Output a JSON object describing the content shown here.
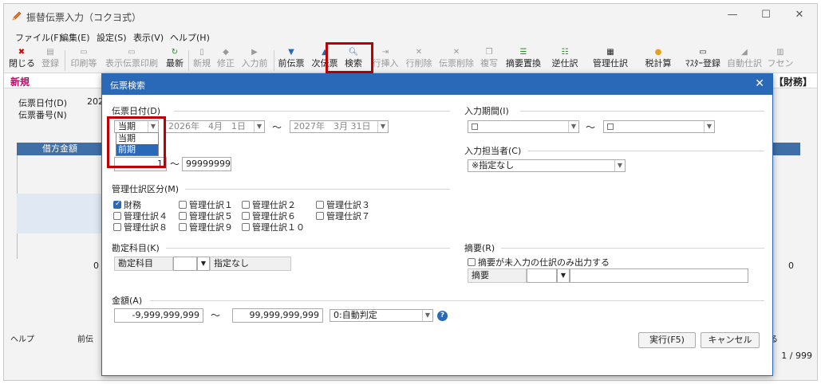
{
  "window": {
    "title": "振替伝票入力（コクヨ式）",
    "controls": {
      "minimize": "—",
      "maximize": "☐",
      "close": "✕"
    }
  },
  "menu": [
    "ファイル(F)",
    "編集(E)",
    "設定(S)",
    "表示(V)",
    "ヘルプ(H)"
  ],
  "toolbar": [
    {
      "label": "閉じる",
      "icon": "close-icon"
    },
    {
      "label": "登録",
      "icon": "register-icon"
    },
    {
      "label": "印刷等",
      "icon": "printer-icon"
    },
    {
      "label": "表示伝票印刷",
      "icon": "printer-icon"
    },
    {
      "label": "最新",
      "icon": "refresh-icon"
    },
    {
      "label": "新規",
      "icon": "new-doc-icon"
    },
    {
      "label": "修正",
      "icon": "edit-icon"
    },
    {
      "label": "入力前",
      "icon": "before-icon"
    },
    {
      "label": "前伝票",
      "icon": "prev-slip-icon"
    },
    {
      "label": "次伝票",
      "icon": "next-slip-icon"
    },
    {
      "label": "検索",
      "icon": "search-icon"
    },
    {
      "label": "行挿入",
      "icon": "row-insert-icon"
    },
    {
      "label": "行削除",
      "icon": "row-delete-icon"
    },
    {
      "label": "伝票削除",
      "icon": "slip-delete-icon"
    },
    {
      "label": "複写",
      "icon": "copy-icon"
    },
    {
      "label": "摘要置換",
      "icon": "replace-icon"
    },
    {
      "label": "逆仕訳",
      "icon": "reverse-icon"
    },
    {
      "label": "管理仕訳",
      "icon": "manage-icon"
    },
    {
      "label": "税計算",
      "icon": "tax-icon"
    },
    {
      "label": "ﾏｽﾀｰ登録",
      "icon": "master-icon"
    },
    {
      "label": "自動仕訳",
      "icon": "auto-icon"
    },
    {
      "label": "フセン",
      "icon": "sticky-icon"
    }
  ],
  "tab": {
    "new": "新規",
    "mode": "【財務】"
  },
  "background": {
    "date_label": "伝票日付(D)",
    "date_value": "202",
    "number_label": "伝票番号(N)",
    "debit_header": "借方金額",
    "debit_total": "0",
    "credit_total": "0",
    "status_help": "ヘルプ",
    "status_prev": "前伝",
    "status_suffix": "る",
    "page": "1 / 999"
  },
  "dialog": {
    "title": "伝票検索",
    "slip_date": {
      "label": "伝票日付(D)",
      "period_selected": "当期",
      "period_options": [
        "当期",
        "前期"
      ],
      "from_date": "2026年　4月　1日",
      "to_date": "2027年　3月 31日"
    },
    "slip_number": {
      "from": "1",
      "to": "99999999"
    },
    "input_period": {
      "label": "入力期間(I)"
    },
    "input_person": {
      "label": "入力担当者(C)",
      "value": "※指定なし"
    },
    "mgmt": {
      "label": "管理仕訳区分(M)",
      "items": [
        {
          "label": "財務",
          "checked": true
        },
        {
          "label": "管理仕訳１",
          "checked": false
        },
        {
          "label": "管理仕訳２",
          "checked": false
        },
        {
          "label": "管理仕訳３",
          "checked": false
        },
        {
          "label": "管理仕訳４",
          "checked": false
        },
        {
          "label": "管理仕訳５",
          "checked": false
        },
        {
          "label": "管理仕訳６",
          "checked": false
        },
        {
          "label": "管理仕訳７",
          "checked": false
        },
        {
          "label": "管理仕訳８",
          "checked": false
        },
        {
          "label": "管理仕訳９",
          "checked": false
        },
        {
          "label": "管理仕訳１０",
          "checked": false
        }
      ]
    },
    "account": {
      "label": "勘定科目(K)",
      "field_label": "勘定科目",
      "value": "指定なし"
    },
    "summary": {
      "label": "摘要(R)",
      "checkbox": "摘要が未入力の仕訳のみ出力する",
      "field_label": "摘要"
    },
    "amount": {
      "label": "金額(A)",
      "from": "-9,999,999,999",
      "to": "99,999,999,999",
      "mode": "0:自動判定"
    },
    "buttons": {
      "run": "実行(F5)",
      "cancel": "キャンセル"
    }
  },
  "colors": {
    "accent": "#2a68b8",
    "highlight_box": "#c00000",
    "new_tab": "#d0006f"
  }
}
